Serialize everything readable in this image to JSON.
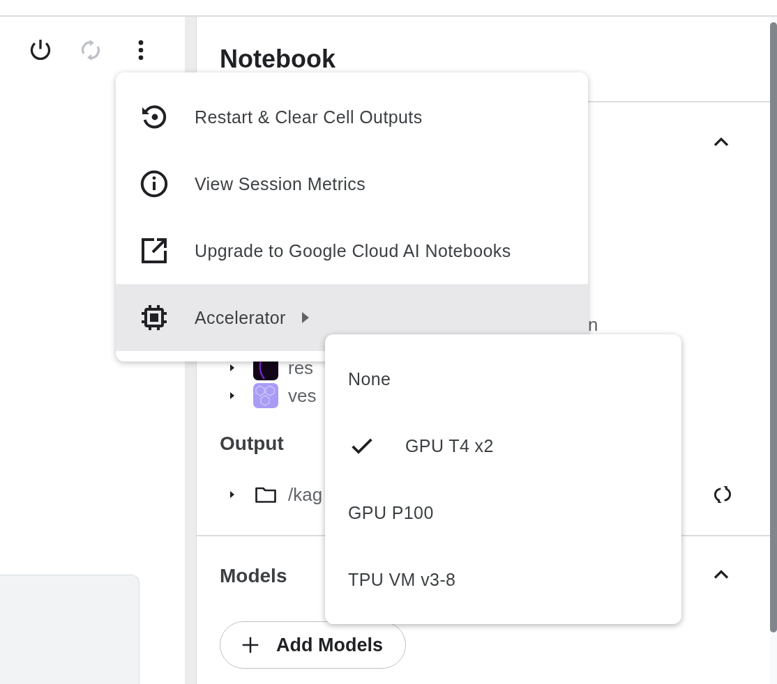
{
  "toolbar": [
    {
      "kind": "power",
      "disabled": false
    },
    {
      "kind": "sync",
      "disabled": true
    },
    {
      "kind": "more",
      "disabled": false
    }
  ],
  "title": "Notebook",
  "data_section": {
    "expanded": true,
    "items": [
      {
        "label": "n",
        "kind": "text"
      },
      {
        "label": "res",
        "kind": "dark-logo"
      },
      {
        "label": "ves",
        "kind": "hex-logo"
      }
    ]
  },
  "output": {
    "heading": "Output",
    "items": [
      {
        "label": "/kag",
        "kind": "folder"
      }
    ]
  },
  "models": {
    "heading": "Models",
    "expanded": true,
    "button": "Add Models"
  },
  "menu": [
    {
      "label": "Restart & Clear Cell Outputs",
      "kind": "restart",
      "selected": false,
      "has_submenu": false
    },
    {
      "label": "View Session Metrics",
      "kind": "info",
      "selected": false,
      "has_submenu": false
    },
    {
      "label": "Upgrade to Google Cloud AI Notebooks",
      "kind": "external",
      "selected": false,
      "has_submenu": false
    },
    {
      "label": "Accelerator",
      "kind": "chip",
      "selected": true,
      "has_submenu": true
    }
  ],
  "submenu": [
    {
      "label": "None",
      "selected": false
    },
    {
      "label": "GPU T4 x2",
      "selected": true
    },
    {
      "label": "GPU P100",
      "selected": false
    },
    {
      "label": "TPU VM v3-8",
      "selected": false
    }
  ]
}
